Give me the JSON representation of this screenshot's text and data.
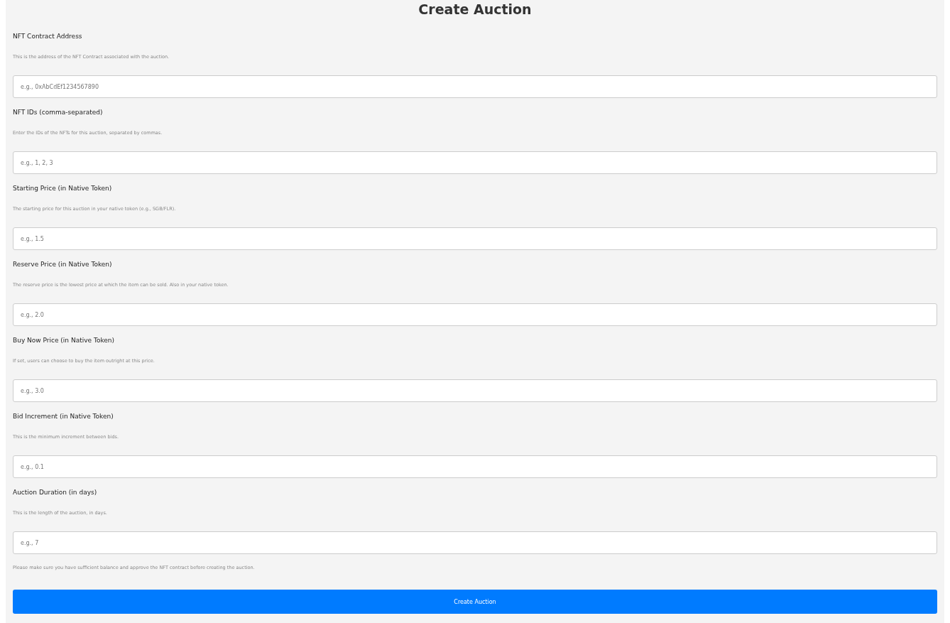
{
  "title": "Create Auction",
  "fields": [
    {
      "label": "NFT Contract Address",
      "description": "This is the address of the NFT Contract associated with the auction.",
      "placeholder": "e.g., 0xAbCdEf1234567890"
    },
    {
      "label": "NFT IDs (comma-separated)",
      "description": "Enter the IDs of the NFTs for this auction, separated by commas.",
      "placeholder": "e.g., 1, 2, 3"
    },
    {
      "label": "Starting Price (in Native Token)",
      "description": "The starting price for this auction in your native token (e.g., SGB/FLR).",
      "placeholder": "e.g., 1.5"
    },
    {
      "label": "Reserve Price (in Native Token)",
      "description": "The reserve price is the lowest price at which the item can be sold. Also in your native token.",
      "placeholder": "e.g., 2.0"
    },
    {
      "label": "Buy Now Price (in Native Token)",
      "description": "If set, users can choose to buy the item outright at this price.",
      "placeholder": "e.g., 3.0"
    },
    {
      "label": "Bid Increment (in Native Token)",
      "description": "This is the minimum increment between bids.",
      "placeholder": "e.g., 0.1"
    },
    {
      "label": "Auction Duration (in days)",
      "description": "This is the length of the auction, in days.",
      "placeholder": "e.g., 7"
    }
  ],
  "note": "Please make sure you have sufficient balance and approve the NFT contract before creating the auction.",
  "submit_button": "Create Auction"
}
